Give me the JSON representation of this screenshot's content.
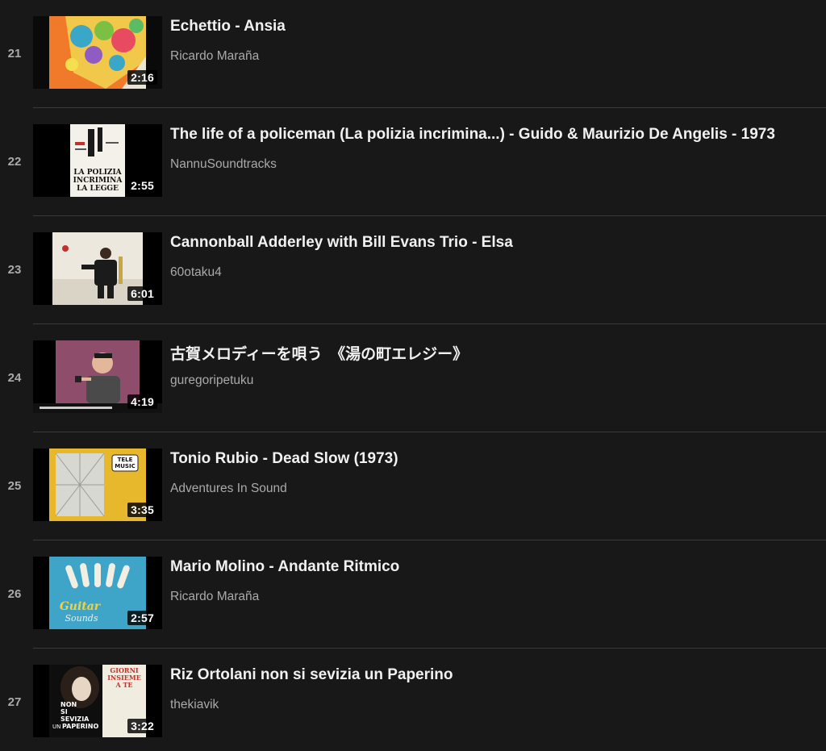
{
  "playlist": {
    "items": [
      {
        "index": "21",
        "title": "Echettio - Ansia",
        "channel": "Ricardo Maraña",
        "duration": "2:16",
        "thumb_icon": "colorful-album-art"
      },
      {
        "index": "22",
        "title": "The life of a policeman (La polizia incrimina...) - Guido & Maurizio De Angelis - 1973",
        "channel": "NannuSoundtracks",
        "duration": "2:55",
        "thumb_icon": "la-polizia-incrimina-poster",
        "thumb_text": [
          "LA POLIZIA",
          "INCRIMINA",
          "LA LEGGE"
        ]
      },
      {
        "index": "23",
        "title": "Cannonball Adderley with Bill Evans Trio - Elsa",
        "channel": "60otaku4",
        "duration": "6:01",
        "thumb_icon": "saxophonist-album-cover"
      },
      {
        "index": "24",
        "title": "古賀メロディーを唄う　《湯の町エレジー》",
        "channel": "guregoripetuku",
        "duration": "4:19",
        "thumb_icon": "singer-video-still"
      },
      {
        "index": "25",
        "title": "Tonio Rubio - Dead Slow (1973)",
        "channel": "Adventures In Sound",
        "duration": "3:35",
        "thumb_icon": "tele-music-album-cover",
        "thumb_text": [
          "TELE",
          "MUSIC"
        ]
      },
      {
        "index": "26",
        "title": "Mario Molino - Andante Ritmico",
        "channel": "Ricardo Maraña",
        "duration": "2:57",
        "thumb_icon": "guitar-sounds-album-cover",
        "thumb_text": [
          "Guitar",
          "Sounds"
        ]
      },
      {
        "index": "27",
        "title": "Riz Ortolani non si sevizia un Paperino",
        "channel": "thekiavik",
        "duration": "3:22",
        "thumb_icon": "non-si-sevizia-un-paperino-cover",
        "thumb_text": [
          "NON",
          "SI",
          "SEVIZIA",
          "UN",
          "PAPERINO",
          "GIORNI",
          "INSIEME",
          "A TE"
        ]
      }
    ]
  }
}
